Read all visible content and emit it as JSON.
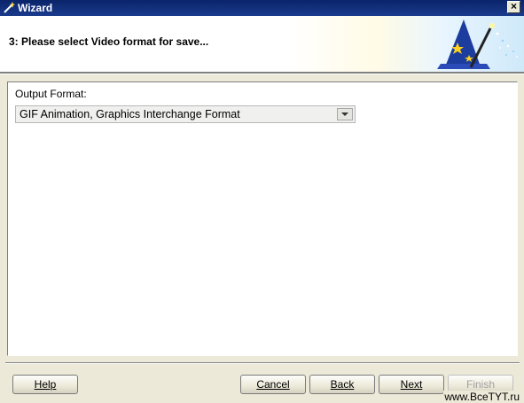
{
  "window": {
    "title": "Wizard",
    "close_label": "×"
  },
  "header": {
    "step_title": "3: Please select Video format for save..."
  },
  "form": {
    "output_label": "Output Format:",
    "output_value": "GIF Animation, Graphics Interchange Format"
  },
  "buttons": {
    "help": "Help",
    "cancel": "Cancel",
    "back": "Back",
    "next": "Next",
    "finish": "Finish"
  },
  "watermark": "www.BceTYT.ru",
  "colors": {
    "titlebar": "#0a246a",
    "dialog_bg": "#ece9d8",
    "panel_bg": "#ffffff"
  }
}
